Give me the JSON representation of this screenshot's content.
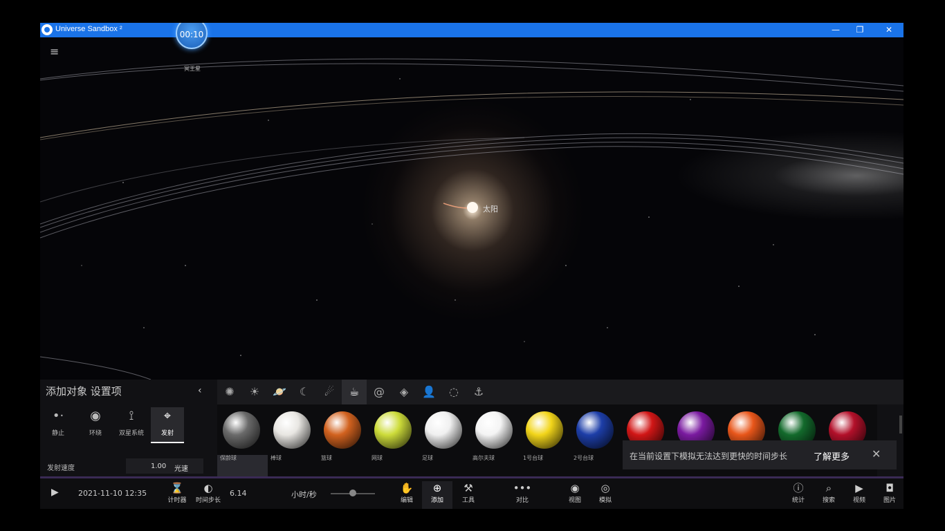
{
  "titlebar": {
    "title": "Universe Sandbox ²",
    "minimize": "—",
    "restore": "❐",
    "close": "✕"
  },
  "timer_badge": "00:10",
  "space": {
    "corner_label": "冥王星",
    "sun_label": "太阳"
  },
  "panel": {
    "title": "添加对象 设置项",
    "modes": [
      {
        "label": "静止",
        "icon": "dot-arrow-icon"
      },
      {
        "label": "环绕",
        "icon": "orbit-icon"
      },
      {
        "label": "双星系统",
        "icon": "binary-icon"
      },
      {
        "label": "发射",
        "icon": "crosshair-icon",
        "active": true
      }
    ],
    "speed": {
      "label": "发射速度",
      "value": "1.00",
      "unit": "光速"
    },
    "categories": [
      "galaxy-icon",
      "star-icon",
      "planet-icon",
      "moon-icon",
      "comet-icon",
      "teapot-icon",
      "spiral-icon",
      "shape-icon",
      "people-icon",
      "sphere-icon",
      "anchor-icon"
    ],
    "objects": [
      {
        "name": "保龄球",
        "color": "#6a6a6a"
      },
      {
        "name": "棒球",
        "color": "#e8e6e2"
      },
      {
        "name": "篮球",
        "color": "#d2621f"
      },
      {
        "name": "网球",
        "color": "#cddc3a"
      },
      {
        "name": "足球",
        "color": "#f0f0f0"
      },
      {
        "name": "高尔夫球",
        "color": "#f4f4f4"
      },
      {
        "name": "1号台球",
        "color": "#f2d51a"
      },
      {
        "name": "2号台球",
        "color": "#1d3ea8"
      },
      {
        "name": "",
        "color": "#d11616"
      },
      {
        "name": "",
        "color": "#7a1aa0"
      },
      {
        "name": "",
        "color": "#e8561a"
      },
      {
        "name": "",
        "color": "#136a2c"
      },
      {
        "name": "",
        "color": "#b3102a"
      }
    ]
  },
  "toast": {
    "text": "在当前设置下模拟无法达到更快的时间步长",
    "link": "了解更多",
    "close": "✕"
  },
  "bottombar": {
    "datetime": "2021-11-10 12:35",
    "timer_label": "计时器",
    "step_label": "时间步长",
    "step_value": "6.14",
    "unit": "小时/秒",
    "slider": 0.5,
    "tools": [
      {
        "label": "编辑",
        "icon": "hand-icon"
      },
      {
        "label": "添加",
        "icon": "plus-circle-icon",
        "active": true
      },
      {
        "label": "工具",
        "icon": "tool-icon"
      },
      {
        "label": "对比",
        "icon": "compare-icon"
      },
      {
        "label": "视图",
        "icon": "eye-icon"
      },
      {
        "label": "模拟",
        "icon": "sim-icon"
      },
      {
        "label": "统计",
        "icon": "info-icon"
      },
      {
        "label": "搜索",
        "icon": "search-icon"
      },
      {
        "label": "视频",
        "icon": "video-icon"
      },
      {
        "label": "图片",
        "icon": "camera-icon"
      }
    ]
  }
}
